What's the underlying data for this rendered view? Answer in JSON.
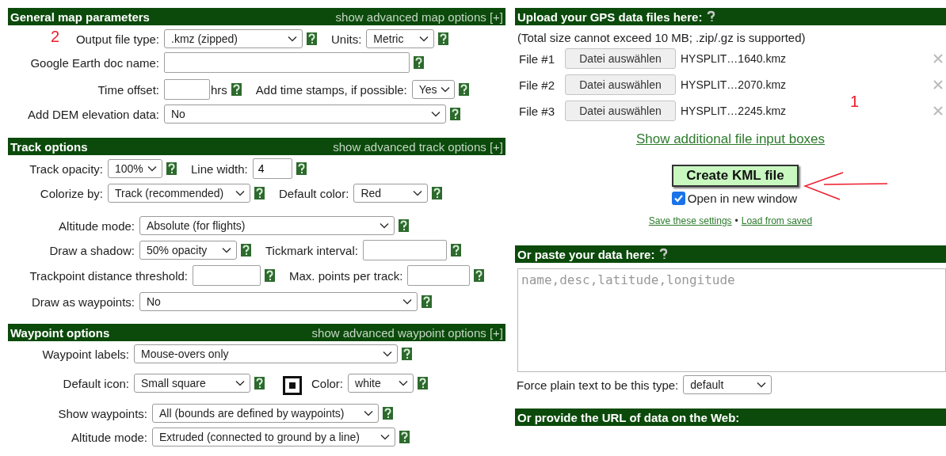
{
  "left_sections": [
    {
      "title": "General map parameters",
      "advanced_link": "show advanced map options [+]",
      "rows": [
        [
          {
            "kind": "select",
            "label": "Output file type:",
            "value": ".kmz (zipped)",
            "marker": "2"
          },
          {
            "kind": "select",
            "label": "Units:",
            "value": "Metric"
          }
        ],
        [
          {
            "kind": "text",
            "label": "Google Earth doc name:"
          }
        ],
        [
          {
            "kind": "text",
            "label": "Time offset:",
            "unit": "hrs"
          },
          {
            "kind": "select",
            "label": "Add time stamps, if possible:",
            "value": "Yes"
          }
        ],
        [
          {
            "kind": "select",
            "label": "Add DEM elevation data:",
            "value": "No"
          }
        ]
      ]
    },
    {
      "title": "Track options",
      "advanced_link": "show advanced track options [+]",
      "rows": [
        [
          {
            "kind": "select",
            "label": "Track opacity:",
            "value": "100%"
          },
          {
            "kind": "text",
            "label": "Line width:",
            "value": "4"
          }
        ],
        [
          {
            "kind": "select",
            "label": "Colorize by:",
            "value": "Track (recommended)"
          },
          {
            "kind": "select",
            "label": "Default color:",
            "value": "Red"
          }
        ],
        [
          {
            "kind": "select",
            "label": "Altitude mode:",
            "value": "Absolute (for flights)"
          }
        ],
        [
          {
            "kind": "select",
            "label": "Draw a shadow:",
            "value": "50% opacity"
          },
          {
            "kind": "text",
            "label": "Tickmark interval:"
          }
        ],
        [
          {
            "kind": "text",
            "label": "Trackpoint distance threshold:"
          },
          {
            "kind": "text",
            "label": "Max. points per track:"
          }
        ],
        [
          {
            "kind": "select",
            "label": "Draw as waypoints:",
            "value": "No"
          }
        ]
      ]
    },
    {
      "title": "Waypoint options",
      "advanced_link": "show advanced waypoint options [+]",
      "rows": [
        [
          {
            "kind": "select",
            "label": "Waypoint labels:",
            "value": "Mouse-overs only"
          }
        ],
        [
          {
            "kind": "select",
            "label": "Default icon:",
            "value": "Small square"
          },
          {
            "kind": "preview"
          },
          {
            "kind": "select",
            "label": "Color:",
            "value": "white"
          }
        ],
        [
          {
            "kind": "select",
            "label": "Show waypoints:",
            "value": "All (bounds are defined by waypoints)"
          }
        ],
        [
          {
            "kind": "select",
            "label": "Altitude mode:",
            "value": "Extruded (connected to ground by a line)"
          }
        ]
      ]
    }
  ],
  "upload": {
    "title": "Upload your GPS data files here:",
    "note": "(Total size cannot exceed 10 MB; .zip/.gz is supported)",
    "files": [
      {
        "label": "File #1",
        "button": "Datei auswählen",
        "filename": "HYSPLIT…1640.kmz"
      },
      {
        "label": "File #2",
        "button": "Datei auswählen",
        "filename": "HYSPLIT…2070.kmz"
      },
      {
        "label": "File #3",
        "button": "Datei auswählen",
        "filename": "HYSPLIT…2245.kmz"
      }
    ],
    "marker": "1",
    "more_link": "Show additional file input boxes",
    "submit": "Create KML file",
    "open_new_window": {
      "label": "Open in new window",
      "checked": true
    },
    "save_link": "Save these settings",
    "separator": "•",
    "load_link": "Load from saved"
  },
  "paste": {
    "title": "Or paste your data here:",
    "placeholder": "name,desc,latitude,longitude",
    "force_label": "Force plain text to be this type:",
    "force_value": "default"
  },
  "url": {
    "title": "Or provide the URL of data on the Web:"
  }
}
